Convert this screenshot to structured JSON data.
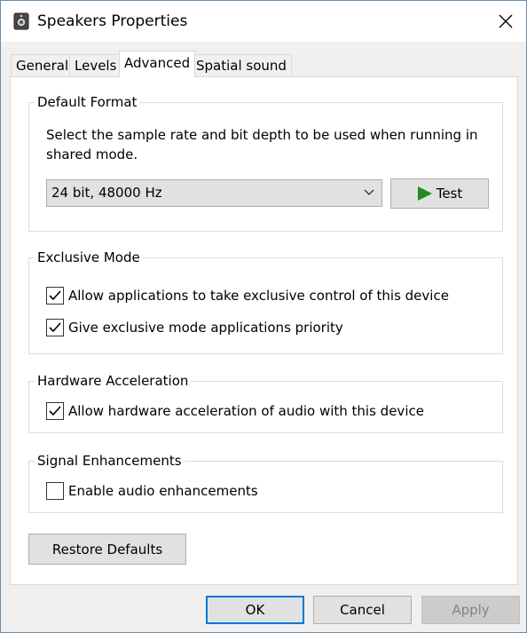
{
  "window": {
    "title": "Speakers Properties",
    "icon": "speaker-icon",
    "close_icon": "close-icon"
  },
  "tabs": [
    {
      "label": "General",
      "active": false
    },
    {
      "label": "Levels",
      "active": false
    },
    {
      "label": "Advanced",
      "active": true
    },
    {
      "label": "Spatial sound",
      "active": false
    }
  ],
  "default_format": {
    "title": "Default Format",
    "description": "Select the sample rate and bit depth to be used when running in shared mode.",
    "selected_format": "24 bit, 48000 Hz",
    "test_label": "Test"
  },
  "exclusive_mode": {
    "title": "Exclusive Mode",
    "options": [
      {
        "label": "Allow applications to take exclusive control of this device",
        "checked": true
      },
      {
        "label": "Give exclusive mode applications priority",
        "checked": true
      }
    ]
  },
  "hardware_acceleration": {
    "title": "Hardware Acceleration",
    "options": [
      {
        "label": "Allow hardware acceleration of audio with this device",
        "checked": true
      }
    ]
  },
  "signal_enhancements": {
    "title": "Signal Enhancements",
    "options": [
      {
        "label": "Enable audio enhancements",
        "checked": false
      }
    ]
  },
  "restore_defaults_label": "Restore Defaults",
  "footer": {
    "ok_label": "OK",
    "cancel_label": "Cancel",
    "apply_label": "Apply",
    "apply_enabled": false
  },
  "colors": {
    "accent": "#0078d7",
    "play_green": "#1e8c1e"
  }
}
